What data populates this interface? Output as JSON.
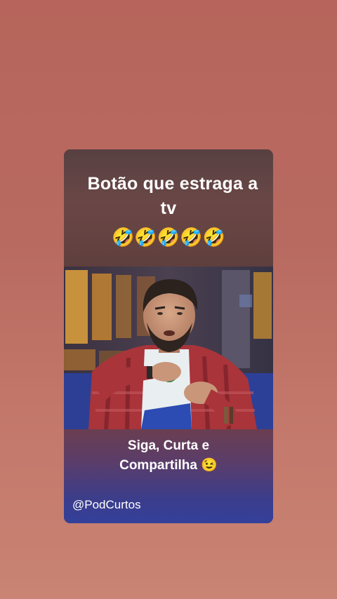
{
  "story": {
    "caption_line1": "Botão que estraga a",
    "caption_line2": "tv",
    "emojis": "🤣🤣🤣🤣🤣",
    "cta_line1": "Siga, Curta e",
    "cta_line2": "Compartilha 😉",
    "handle": "@PodCurtos"
  },
  "colors": {
    "background": "#b86a60",
    "card_top": "#5f3f3d",
    "card_bottom": "#34409a",
    "text": "#ffffff"
  }
}
